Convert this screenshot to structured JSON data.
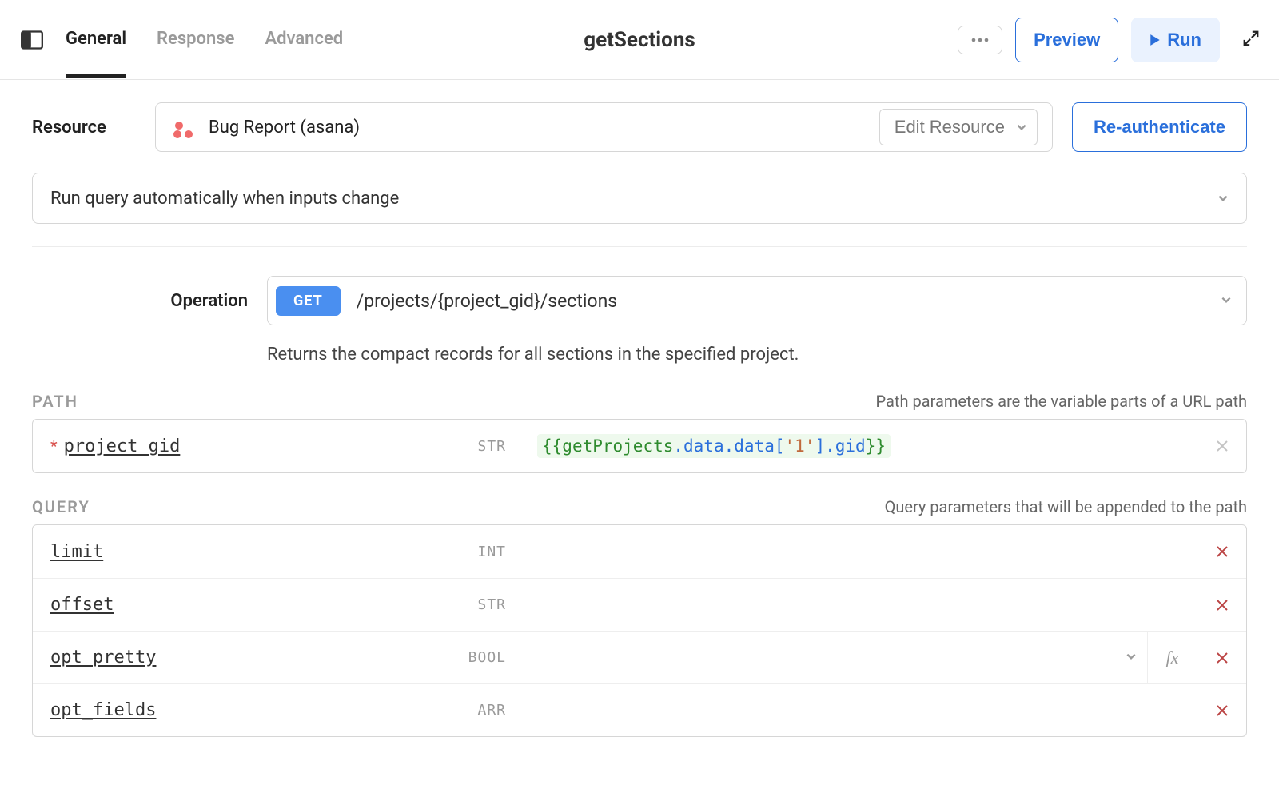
{
  "header": {
    "tabs": [
      "General",
      "Response",
      "Advanced"
    ],
    "active_tab": 0,
    "title": "getSections",
    "preview_label": "Preview",
    "run_label": "Run"
  },
  "resource": {
    "label": "Resource",
    "name": "Bug Report (asana)",
    "edit_label": "Edit Resource",
    "reauth_label": "Re-authenticate"
  },
  "run_mode": "Run query automatically when inputs change",
  "operation": {
    "label": "Operation",
    "method": "GET",
    "endpoint": "/projects/{project_gid}/sections",
    "description": "Returns the compact records for all sections in the specified project."
  },
  "path_section": {
    "title": "PATH",
    "description": "Path parameters are the variable parts of a URL path",
    "params": [
      {
        "name": "project_gid",
        "type": "STR",
        "required": true,
        "value_tokens": [
          {
            "t": "br",
            "v": "{{"
          },
          {
            "t": "g",
            "v": "getProjects"
          },
          {
            "t": "b",
            "v": "."
          },
          {
            "t": "b",
            "v": "data"
          },
          {
            "t": "b",
            "v": "."
          },
          {
            "t": "b",
            "v": "data"
          },
          {
            "t": "b",
            "v": "["
          },
          {
            "t": "o",
            "v": "'1'"
          },
          {
            "t": "b",
            "v": "]"
          },
          {
            "t": "b",
            "v": "."
          },
          {
            "t": "b",
            "v": "gid"
          },
          {
            "t": "br",
            "v": "}}"
          }
        ]
      }
    ]
  },
  "query_section": {
    "title": "QUERY",
    "description": "Query parameters that will be appended to the path",
    "params": [
      {
        "name": "limit",
        "type": "INT"
      },
      {
        "name": "offset",
        "type": "STR"
      },
      {
        "name": "opt_pretty",
        "type": "BOOL",
        "has_dropdown": true,
        "has_fx": true
      },
      {
        "name": "opt_fields",
        "type": "ARR"
      }
    ]
  }
}
